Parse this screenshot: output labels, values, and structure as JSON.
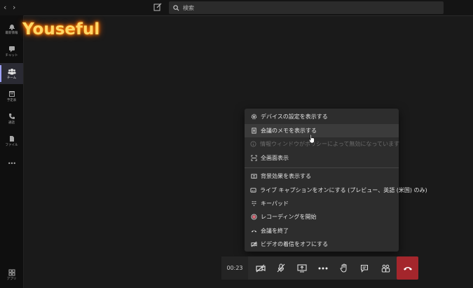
{
  "topbar": {
    "search_placeholder": "検索"
  },
  "sidebar": {
    "items": [
      {
        "label": "最新情報",
        "icon": "bell-icon"
      },
      {
        "label": "チャット",
        "icon": "chat-icon"
      },
      {
        "label": "チーム",
        "icon": "teams-icon",
        "active": true
      },
      {
        "label": "予定表",
        "icon": "calendar-icon"
      },
      {
        "label": "通話",
        "icon": "phone-icon"
      },
      {
        "label": "ファイル",
        "icon": "file-icon"
      },
      {
        "label": "•••",
        "icon": "more-icon"
      }
    ],
    "apps_label": "アプリ"
  },
  "watermark": {
    "text": "Youseful"
  },
  "menu": {
    "items": [
      {
        "label": "デバイスの設定を表示する",
        "icon": "settings-icon"
      },
      {
        "label": "会議のメモを表示する",
        "icon": "notes-icon"
      },
      {
        "label": "情報ウィンドウがポリシーによって無効になっています",
        "icon": "info-icon"
      },
      {
        "label": "全画面表示",
        "icon": "fullscreen-icon"
      },
      {
        "label": "背景効果を表示する",
        "icon": "background-effects-icon"
      },
      {
        "label": "ライブ キャプションをオンにする (プレビュー、英語 (米国) のみ)",
        "icon": "captions-icon"
      },
      {
        "label": "キーパッド",
        "icon": "keypad-icon"
      },
      {
        "label": "レコーディングを開始",
        "icon": "record-icon"
      },
      {
        "label": "会議を終了",
        "icon": "end-meeting-icon"
      },
      {
        "label": "ビデオの着信をオフにする",
        "icon": "video-off-icon"
      }
    ]
  },
  "callbar": {
    "timer": "00:23"
  },
  "colors": {
    "hangup": "#a4262c",
    "accent": "#9ea2ff",
    "record": "#e06b7a",
    "logo": "#ffd866"
  }
}
